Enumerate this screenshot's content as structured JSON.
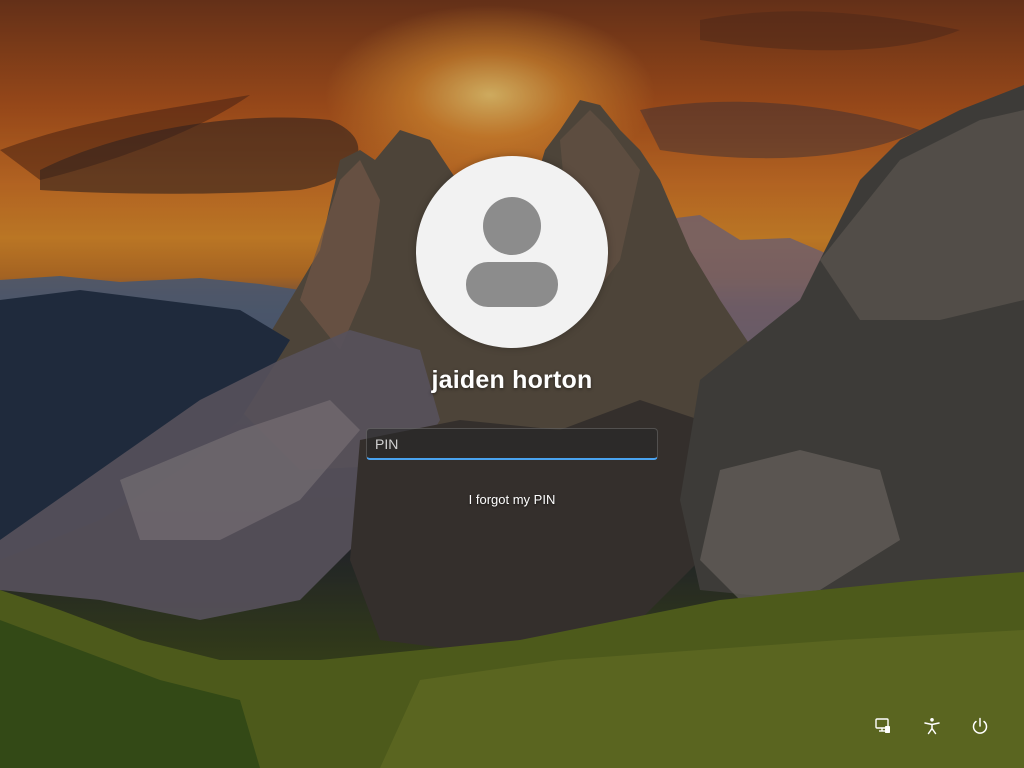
{
  "user": {
    "name": "jaiden horton"
  },
  "pin": {
    "placeholder": "PIN",
    "value": ""
  },
  "links": {
    "forgot_pin": "I forgot my PIN"
  },
  "icons": {
    "avatar": "user-avatar-icon",
    "network": "network-icon",
    "accessibility": "accessibility-icon",
    "power": "power-icon"
  },
  "colors": {
    "input_focus_underline": "#4aa3f0",
    "text": "#ffffff",
    "avatar_bg": "#f2f2f2",
    "avatar_glyph": "#8c8c8c"
  }
}
